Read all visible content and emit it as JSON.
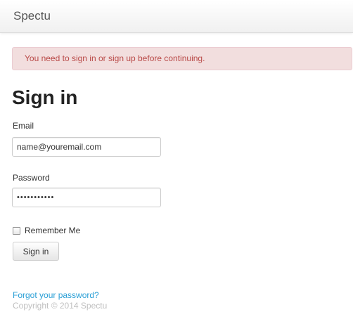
{
  "navbar": {
    "brand": "Spectu"
  },
  "alert": {
    "message": "You need to sign in or sign up before continuing."
  },
  "form": {
    "title": "Sign in",
    "email_label": "Email",
    "email_value": "name@youremail.com",
    "password_label": "Password",
    "password_value": "•••••••••••",
    "remember_label": "Remember Me",
    "remember_checked": false,
    "submit_label": "Sign in"
  },
  "links": {
    "forgot_password": "Forgot your password?"
  },
  "footer": {
    "copyright": "Copyright © 2014 Spectu"
  },
  "colors": {
    "alert_background": "#f2dede",
    "alert_text": "#b94a48",
    "link": "#2a9fd6"
  }
}
